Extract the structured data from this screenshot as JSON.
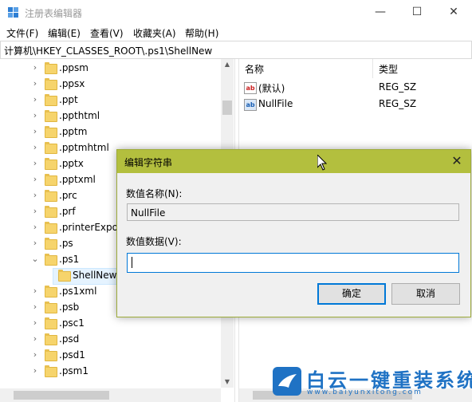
{
  "window": {
    "title": "注册表编辑器"
  },
  "menu": [
    "文件(F)",
    "编辑(E)",
    "查看(V)",
    "收藏夹(A)",
    "帮助(H)"
  ],
  "address": "计算机\\HKEY_CLASSES_ROOT\\.ps1\\ShellNew",
  "tree": [
    {
      "label": ".ppsm",
      "arrow": "›"
    },
    {
      "label": ".ppsx",
      "arrow": "›"
    },
    {
      "label": ".ppt",
      "arrow": "›"
    },
    {
      "label": ".ppthtml",
      "arrow": "›"
    },
    {
      "label": ".pptm",
      "arrow": "›"
    },
    {
      "label": ".pptmhtml",
      "arrow": "›"
    },
    {
      "label": ".pptx",
      "arrow": "›"
    },
    {
      "label": ".pptxml",
      "arrow": "›"
    },
    {
      "label": ".prc",
      "arrow": "›"
    },
    {
      "label": ".prf",
      "arrow": "›"
    },
    {
      "label": ".printerExport",
      "arrow": "›"
    },
    {
      "label": ".ps",
      "arrow": "›"
    },
    {
      "label": ".ps1",
      "arrow": "⌄"
    },
    {
      "label": "ShellNew",
      "arrow": ""
    },
    {
      "label": ".ps1xml",
      "arrow": "›"
    },
    {
      "label": ".psb",
      "arrow": "›"
    },
    {
      "label": ".psc1",
      "arrow": "›"
    },
    {
      "label": ".psd",
      "arrow": "›"
    },
    {
      "label": ".psd1",
      "arrow": "›"
    },
    {
      "label": ".psm1",
      "arrow": "›"
    }
  ],
  "list": {
    "col_name": "名称",
    "col_type": "类型",
    "rows": [
      {
        "name": "(默认)",
        "type": "REG_SZ",
        "icon": "ab"
      },
      {
        "name": "NullFile",
        "type": "REG_SZ",
        "icon": "ab"
      }
    ]
  },
  "dialog": {
    "title": "编辑字符串",
    "name_label": "数值名称(N):",
    "name_value": "NullFile",
    "data_label": "数值数据(V):",
    "data_value": "",
    "ok": "确定",
    "cancel": "取消"
  },
  "watermark": {
    "text": "白云一键重装系统",
    "url": "www.baiyunxitong.com"
  },
  "colors": {
    "dialog_title": "#b3bf3e",
    "folder": "#f6d46c",
    "accent": "#0078d7"
  }
}
